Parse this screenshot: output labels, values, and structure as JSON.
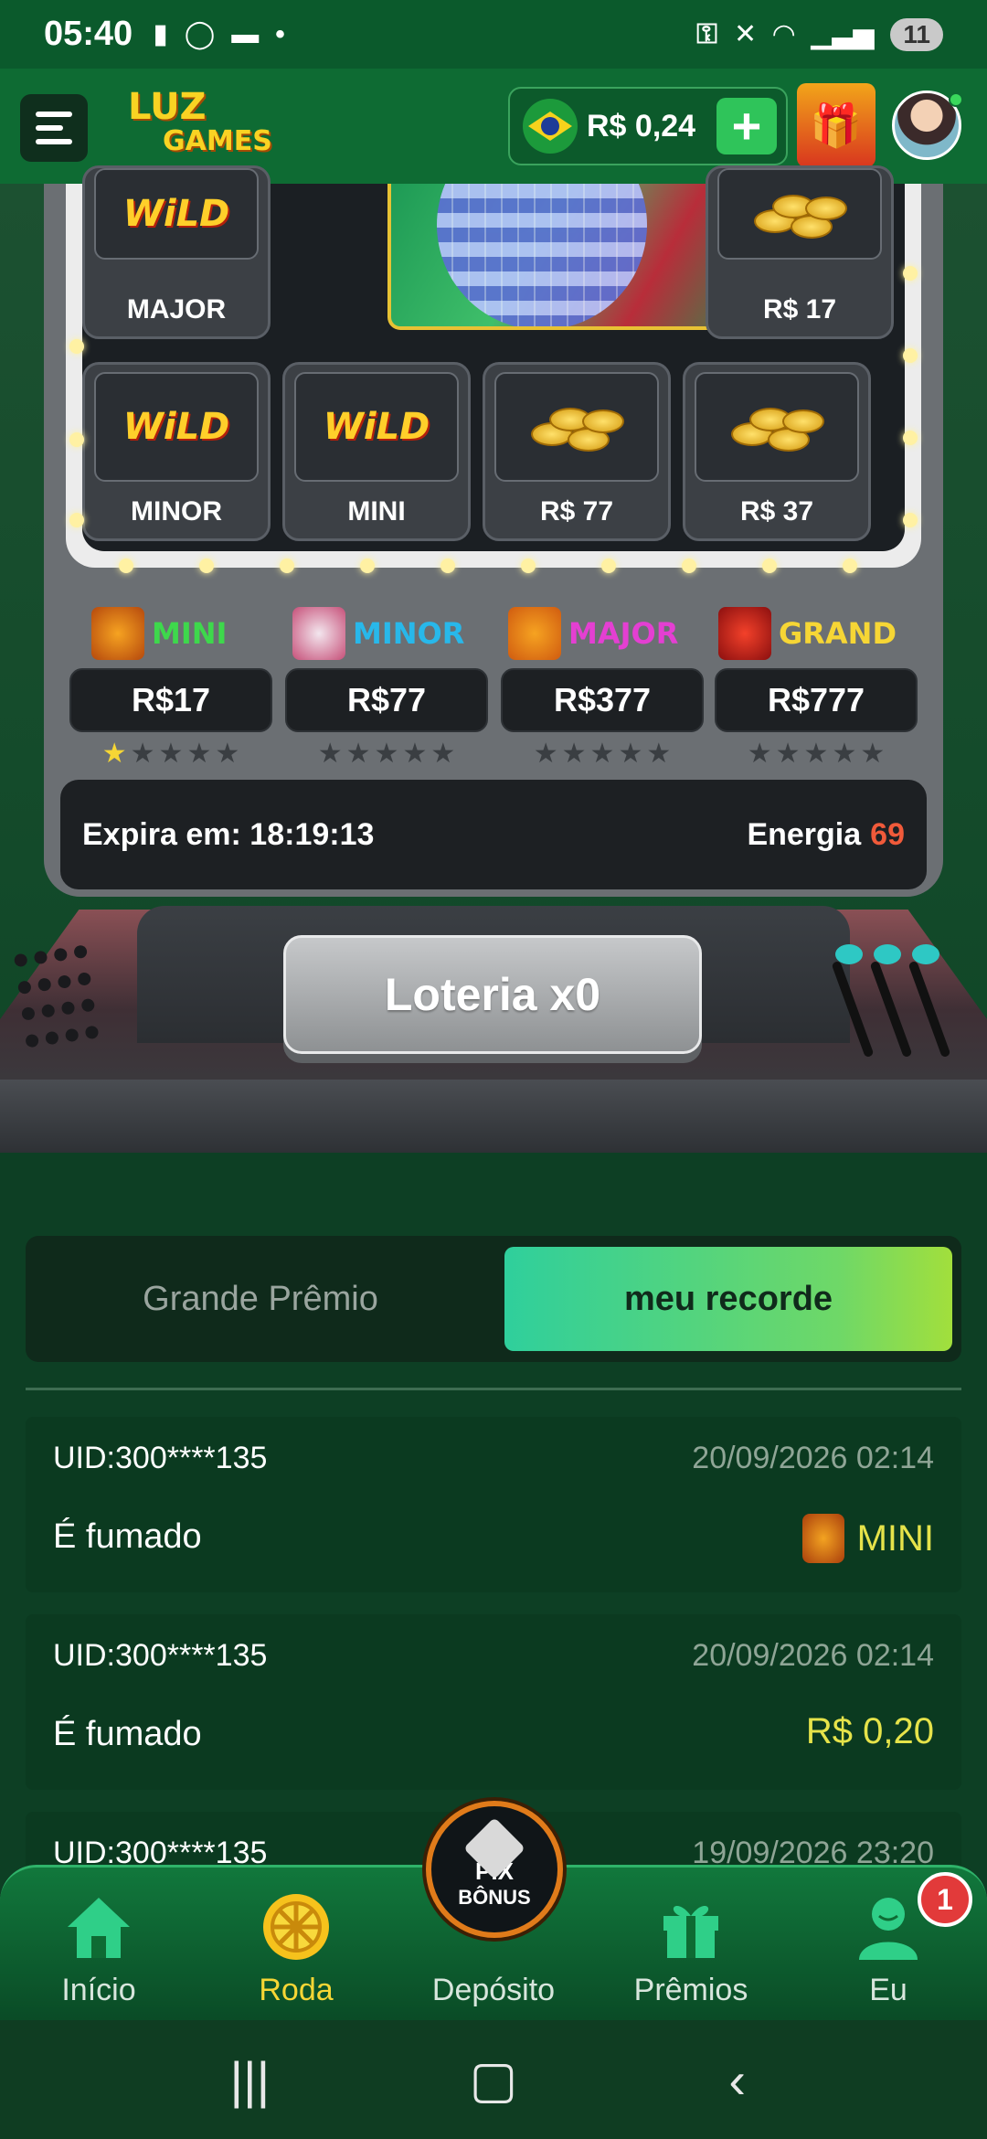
{
  "status_bar": {
    "time": "05:40",
    "battery": "11"
  },
  "header": {
    "logo_line1": "LUZ",
    "logo_line2": "GAMES",
    "balance": "R$ 0,24",
    "add_label": "+"
  },
  "reels": {
    "row1": [
      {
        "label": "MAJOR",
        "icon": "wild-tiger"
      },
      {
        "label": "R$ 17",
        "icon": "gold-coins"
      }
    ],
    "row2": [
      {
        "label": "MINOR",
        "icon": "wild-rabbit"
      },
      {
        "label": "MINI",
        "icon": "wild-dragon"
      },
      {
        "label": "R$ 77",
        "icon": "gold-coins"
      },
      {
        "label": "R$ 37",
        "icon": "gold-coins"
      }
    ],
    "wild_text": "WiLD"
  },
  "jackpots": [
    {
      "name": "MINI",
      "value": "R$17",
      "color": "#3ed84c",
      "stars_filled": 1
    },
    {
      "name": "MINOR",
      "value": "R$77",
      "color": "#28b8ea",
      "stars_filled": 0
    },
    {
      "name": "MAJOR",
      "value": "R$377",
      "color": "#e43fd2",
      "stars_filled": 0
    },
    {
      "name": "GRAND",
      "value": "R$777",
      "color": "#f6d635",
      "stars_filled": 0
    }
  ],
  "timer": {
    "expires_label": "Expira em: 18:19:13",
    "energy_label": "Energia",
    "energy_value": "69"
  },
  "action": {
    "lottery_button": "Loteria x0"
  },
  "tabs": {
    "inactive": "Grande Prêmio",
    "active": "meu recorde"
  },
  "records": [
    {
      "uid": "UID:300****135",
      "date": "20/09/2026 02:14",
      "desc": "É fumado",
      "prize": "MINI",
      "has_icon": true
    },
    {
      "uid": "UID:300****135",
      "date": "20/09/2026 02:14",
      "desc": "É fumado",
      "prize": "R$ 0,20",
      "has_icon": false
    },
    {
      "uid": "UID:300****135",
      "date": "19/09/2026 23:20",
      "desc": "",
      "prize": "",
      "has_icon": false
    }
  ],
  "bottom_nav": {
    "items": [
      {
        "label": "Início",
        "icon": "home-icon"
      },
      {
        "label": "Roda",
        "icon": "wheel-icon"
      },
      {
        "label": "Depósito",
        "icon": "pix-bonus-icon"
      },
      {
        "label": "Prêmios",
        "icon": "gift-icon"
      },
      {
        "label": "Eu",
        "icon": "user-icon"
      }
    ],
    "pix_label": "PIX",
    "pix_sub": "BÔNUS",
    "badge": "1",
    "active_color": "#f6d635"
  }
}
